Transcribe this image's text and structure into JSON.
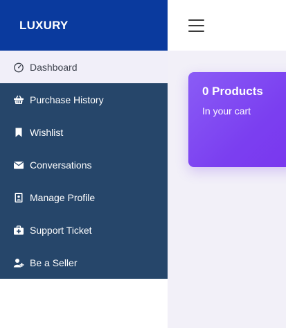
{
  "brand": {
    "name": "LUXURY"
  },
  "colors": {
    "brand_bg": "#0a3a9e",
    "menu_bg": "#26466a",
    "card_accent": "#7b3ff0",
    "active_bg": "#f1eff9"
  },
  "sidebar": {
    "items": [
      {
        "label": "Dashboard",
        "icon": "dashboard-gauge-icon",
        "active": true
      },
      {
        "label": "Purchase History",
        "icon": "shopping-basket-icon"
      },
      {
        "label": "Wishlist",
        "icon": "bookmark-icon"
      },
      {
        "label": "Conversations",
        "icon": "envelope-icon"
      },
      {
        "label": "Manage Profile",
        "icon": "id-badge-icon"
      },
      {
        "label": "Support Ticket",
        "icon": "medkit-icon"
      },
      {
        "label": "Be a Seller",
        "icon": "user-plus-icon"
      }
    ]
  },
  "topbar": {
    "menu_icon": "hamburger-icon"
  },
  "cart_card": {
    "title": "0 Products",
    "subtitle": "In your cart"
  }
}
